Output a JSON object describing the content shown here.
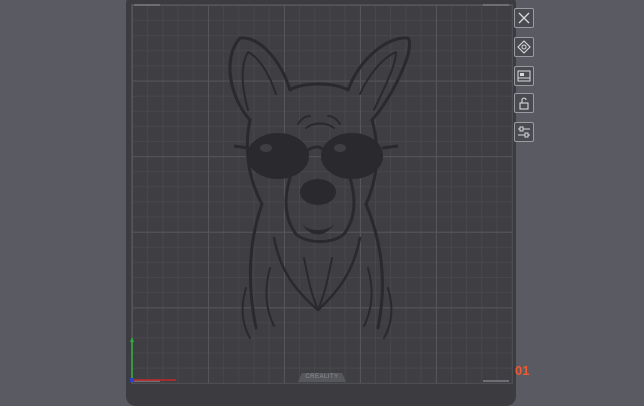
{
  "viewport": {
    "background_color": "#5a5a63",
    "plate_color": "#3e3e43",
    "grid_major_color": "#55555c",
    "grid_minor_color": "#47474d"
  },
  "plate": {
    "brand_label": "CREALITY",
    "index": "01",
    "index_color": "#f0582e"
  },
  "axes": {
    "x_color": "#c0282a",
    "y_color": "#2eae3c",
    "z_color": "#2a44c4"
  },
  "model": {
    "icon": "dog-with-sunglasses-relief",
    "line_color": "#2a2a2e"
  },
  "toolbar": {
    "items": [
      {
        "icon": "close-icon"
      },
      {
        "icon": "auto-arrange-icon"
      },
      {
        "icon": "slice-icon"
      },
      {
        "icon": "unlock-icon"
      },
      {
        "icon": "plate-settings-icon"
      }
    ]
  }
}
